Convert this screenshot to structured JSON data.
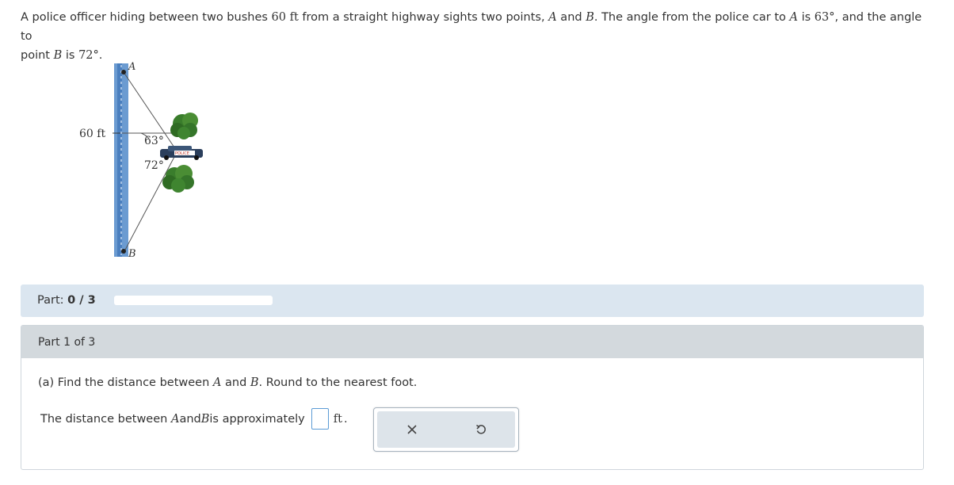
{
  "problem": {
    "s1": "A police officer hiding between two bushes ",
    "dist": "60 ft",
    "s2": " from a straight highway sights two points, ",
    "A": "A",
    "s3": " and ",
    "B": "B",
    "s4": ". The angle from the police car to ",
    "s5": " is ",
    "angleA": "63°",
    "s6": ", and the angle to",
    "s7": "point ",
    "s8": " is ",
    "angleB": "72°",
    "s9": "."
  },
  "figure": {
    "label_A": "A",
    "label_B": "B",
    "label_60": "60 ft",
    "angle_63": "63°",
    "angle_72": "72°",
    "car_text": "POLICE",
    "colors": {
      "road": "#6b9bd1",
      "tree": "#3a7d2c",
      "car": "#2b3f5c"
    }
  },
  "part_bar": {
    "label": "Part:",
    "progress": "0 / 3",
    "progress_fraction": 0
  },
  "part_panel": {
    "header": "Part 1 of 3",
    "q_prefix": "(a) Find the distance between ",
    "q_A": "A",
    "q_and": " and ",
    "q_B": "B",
    "q_suffix": ". Round to the nearest foot.",
    "ans_prefix": "The distance between ",
    "ans_A": "A",
    "ans_and": " and ",
    "ans_B": "B",
    "ans_mid": " is approximately",
    "ans_unit": "ft",
    "ans_period": "."
  },
  "buttons": {
    "clear_icon": "close-icon",
    "reset_icon": "undo-icon"
  }
}
